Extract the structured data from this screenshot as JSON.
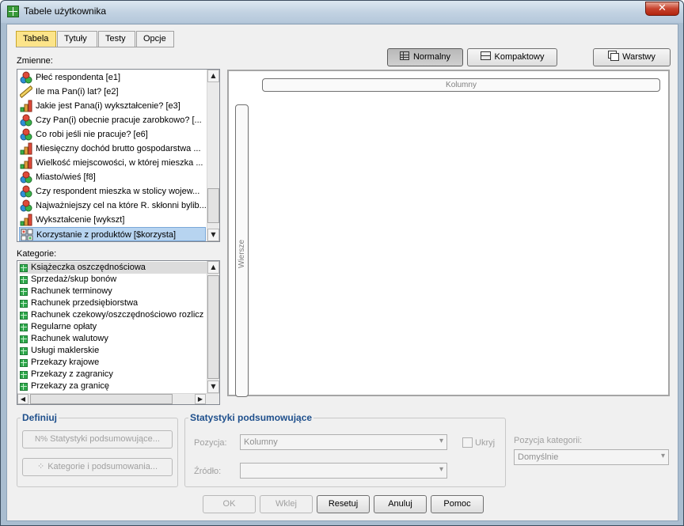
{
  "window": {
    "title": "Tabele użytkownika",
    "close_label": "✕"
  },
  "tabs": [
    {
      "label": "Tabela",
      "active": true
    },
    {
      "label": "Tytuły"
    },
    {
      "label": "Testy"
    },
    {
      "label": "Opcje"
    }
  ],
  "variables_label": "Zmienne:",
  "variables": [
    {
      "label": "Płeć respondenta [e1]",
      "icon": "nominal-icon"
    },
    {
      "label": "Ile ma Pan(i) lat? [e2]",
      "icon": "scale-icon"
    },
    {
      "label": "Jakie jest Pana(i) wykształcenie? [e3]",
      "icon": "ordinal-icon"
    },
    {
      "label": "Czy Pan(i) obecnie pracuje zarobkowo? [...",
      "icon": "nominal-icon"
    },
    {
      "label": "Co robi jeśli nie pracuje? [e6]",
      "icon": "nominal-icon"
    },
    {
      "label": "Miesięczny dochód brutto gospodarstwa ...",
      "icon": "ordinal-icon"
    },
    {
      "label": "Wielkość miejscowości, w której mieszka ...",
      "icon": "ordinal-icon"
    },
    {
      "label": "Miasto/wieś [f8]",
      "icon": "nominal-icon"
    },
    {
      "label": "Czy respondent mieszka w stolicy wojew...",
      "icon": "nominal-icon"
    },
    {
      "label": "Najważniejszy cel na które R. skłonni bylib...",
      "icon": "nominal-icon"
    },
    {
      "label": "Wykształcenie [wykszt]",
      "icon": "ordinal-icon"
    },
    {
      "label": "Korzystanie z produktów [$korzysta]",
      "icon": "multiresponse-set-icon",
      "selected": true
    }
  ],
  "categories_label": "Kategorie:",
  "categories": [
    {
      "label": "Książeczka oszczędnościowa",
      "selected": true
    },
    {
      "label": "Sprzedaż/skup bonów"
    },
    {
      "label": "Rachunek terminowy"
    },
    {
      "label": "Rachunek przedsiębiorstwa"
    },
    {
      "label": "Rachunek czekowy/oszczędnościowo rozlicz"
    },
    {
      "label": "Regularne opłaty"
    },
    {
      "label": "Rachunek walutowy"
    },
    {
      "label": "Usługi maklerskie"
    },
    {
      "label": "Przekazy krajowe"
    },
    {
      "label": "Przekazy z zagranicy"
    },
    {
      "label": "Przekazy za granicę"
    }
  ],
  "view_buttons": {
    "normal": "Normalny",
    "compact": "Kompaktowy",
    "layers": "Warstwy"
  },
  "canvas": {
    "columns": "Kolumny",
    "rows": "Wiersze"
  },
  "define": {
    "title": "Definiuj",
    "summary_stats": "Statystyki podsumowujące...",
    "categories_totals": "Kategorie i podsumowania..."
  },
  "summary": {
    "title": "Statystyki podsumowujące",
    "position_label": "Pozycja:",
    "position_value": "Kolumny",
    "source_label": "Źródło:",
    "source_value": "",
    "hide_label": "Ukryj"
  },
  "category_position": {
    "label": "Pozycja kategorii:",
    "value": "Domyślnie"
  },
  "footer": {
    "ok": "OK",
    "paste": "Wklej",
    "reset": "Resetuj",
    "cancel": "Anuluj",
    "help": "Pomoc"
  }
}
